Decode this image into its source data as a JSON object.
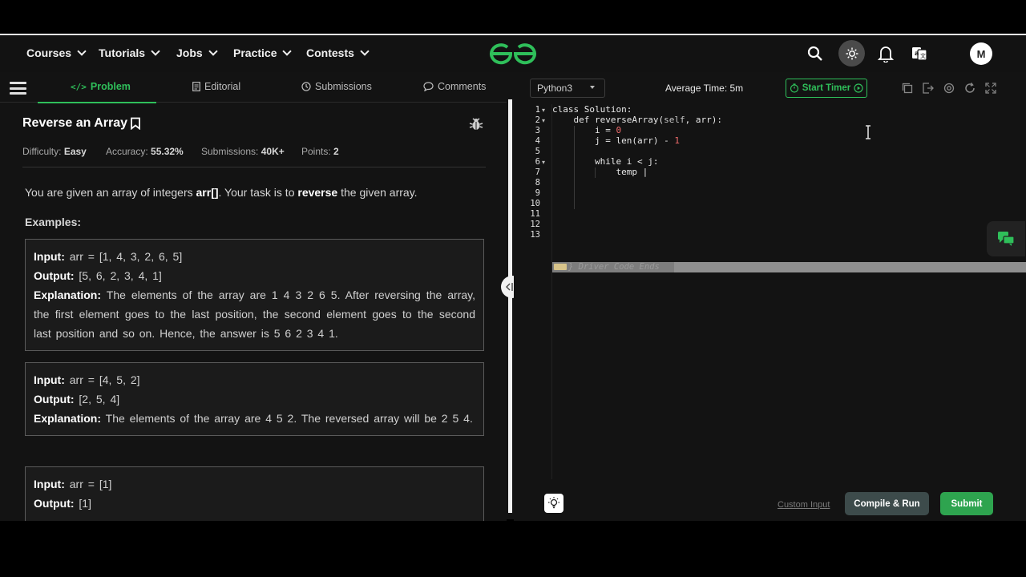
{
  "nav": {
    "items": [
      "Courses",
      "Tutorials",
      "Jobs",
      "Practice",
      "Contests"
    ],
    "logo": "GfG",
    "avatar_initial": "M"
  },
  "tabs": {
    "problem": "Problem",
    "editorial": "Editorial",
    "submissions": "Submissions",
    "comments": "Comments"
  },
  "problem": {
    "title": "Reverse an Array",
    "difficulty_label": "Difficulty:",
    "difficulty": "Easy",
    "accuracy_label": "Accuracy:",
    "accuracy": "55.32%",
    "submissions_label": "Submissions:",
    "submissions": "40K+",
    "points_label": "Points:",
    "points": "2",
    "desc_pre": "You are given an array of integers ",
    "desc_arr": "arr[]",
    "desc_mid": ". Your task is to ",
    "desc_rev": "reverse",
    "desc_post": " the given array.",
    "examples_label": "Examples:",
    "input_label": "Input:",
    "output_label": "Output:",
    "explanation_label": "Explanation:",
    "examples": [
      {
        "input": "arr = [1, 4, 3, 2, 6, 5]",
        "output": "[5, 6, 2, 3, 4, 1]",
        "explanation": "The elements of the array are 1 4 3 2 6 5. After reversing the array, the first element goes to the last position, the second element goes to the second last position and so on. Hence, the answer is 5 6 2 3 4 1."
      },
      {
        "input": "arr = [4, 5, 2]",
        "output": "[2, 5, 4]",
        "explanation": "The elements of the array are 4 5 2. The reversed array will be 2 5 4."
      },
      {
        "input": "arr = [1]",
        "output": "[1]"
      }
    ]
  },
  "editor": {
    "language": "Python3",
    "avg_time": "Average Time: 5m",
    "timer_label": "Start Timer",
    "line_numbers": [
      "1",
      "2",
      "3",
      "4",
      "5",
      "6",
      "7",
      "8",
      "9",
      "10",
      "11",
      "12",
      "13"
    ],
    "lines": {
      "l1": "class Solution:",
      "l2a": "    def reverseArray(",
      "l2b": "self",
      "l2c": ", arr):",
      "l3a": "        i = ",
      "l3b": "0",
      "l4a": "        j = len(arr) - ",
      "l4b": "1",
      "l6": "        while i < j:",
      "l7": "            temp |"
    },
    "driver_text": "} Driver Code Ends"
  },
  "footer": {
    "custom_input": "Custom Input",
    "compile": "Compile & Run",
    "submit": "Submit"
  },
  "colors": {
    "accent_green": "#2fbf5a",
    "submit_green": "#2ea44f",
    "background": "#131313"
  },
  "icons": [
    "search-icon",
    "theme-icon",
    "bell-icon",
    "translate-icon",
    "bookmark-icon",
    "bug-icon",
    "code-icon",
    "document-icon",
    "clock-icon",
    "comment-icon",
    "copy-icon",
    "fullscreen-icon",
    "settings-icon",
    "reset-icon",
    "expand-icon",
    "chat-icon",
    "bulb-icon"
  ]
}
